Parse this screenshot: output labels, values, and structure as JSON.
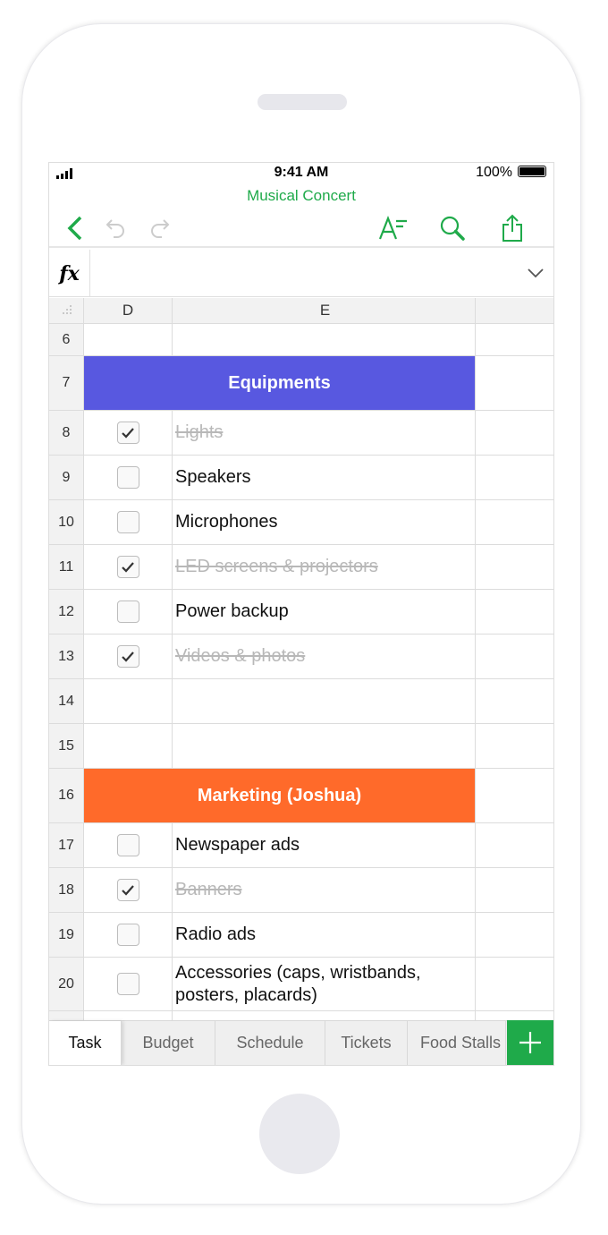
{
  "colors": {
    "accent": "#1faa4a",
    "equipments_band": "#5858e0",
    "marketing_band": "#ff6a2a"
  },
  "status": {
    "time": "9:41 AM",
    "battery": "100%"
  },
  "document_title": "Musical Concert",
  "toolbar": {
    "icons": [
      "chevron-left-icon",
      "undo-icon",
      "redo-icon",
      "text-format-icon",
      "search-icon",
      "share-icon"
    ]
  },
  "formula_bar": {
    "label": "fx",
    "value": ""
  },
  "columns": [
    "D",
    "E"
  ],
  "rows": [
    {
      "num": "6",
      "type": "empty"
    },
    {
      "num": "7",
      "type": "band",
      "label": "Equipments",
      "color": "#5858e0"
    },
    {
      "num": "8",
      "type": "item",
      "checked": true,
      "text": "Lights"
    },
    {
      "num": "9",
      "type": "item",
      "checked": false,
      "text": "Speakers"
    },
    {
      "num": "10",
      "type": "item",
      "checked": false,
      "text": "Microphones"
    },
    {
      "num": "11",
      "type": "item",
      "checked": true,
      "text": "LED screens & projectors"
    },
    {
      "num": "12",
      "type": "item",
      "checked": false,
      "text": "Power backup"
    },
    {
      "num": "13",
      "type": "item",
      "checked": true,
      "text": "Videos & photos"
    },
    {
      "num": "14",
      "type": "blank"
    },
    {
      "num": "15",
      "type": "blank"
    },
    {
      "num": "16",
      "type": "band",
      "label": "Marketing (Joshua)",
      "color": "#ff6a2a"
    },
    {
      "num": "17",
      "type": "item",
      "checked": false,
      "text": "Newspaper ads"
    },
    {
      "num": "18",
      "type": "item",
      "checked": true,
      "text": "Banners"
    },
    {
      "num": "19",
      "type": "item",
      "checked": false,
      "text": "Radio ads"
    },
    {
      "num": "20",
      "type": "item2",
      "checked": false,
      "text": "Accessories (caps, wristbands, posters, placards)"
    },
    {
      "num": "",
      "type": "item",
      "checked": false,
      "text": ""
    }
  ],
  "sheet_tabs": [
    {
      "label": "Task",
      "active": true
    },
    {
      "label": "Budget"
    },
    {
      "label": "Schedule"
    },
    {
      "label": "Tickets"
    },
    {
      "label": "Food Stalls"
    }
  ]
}
